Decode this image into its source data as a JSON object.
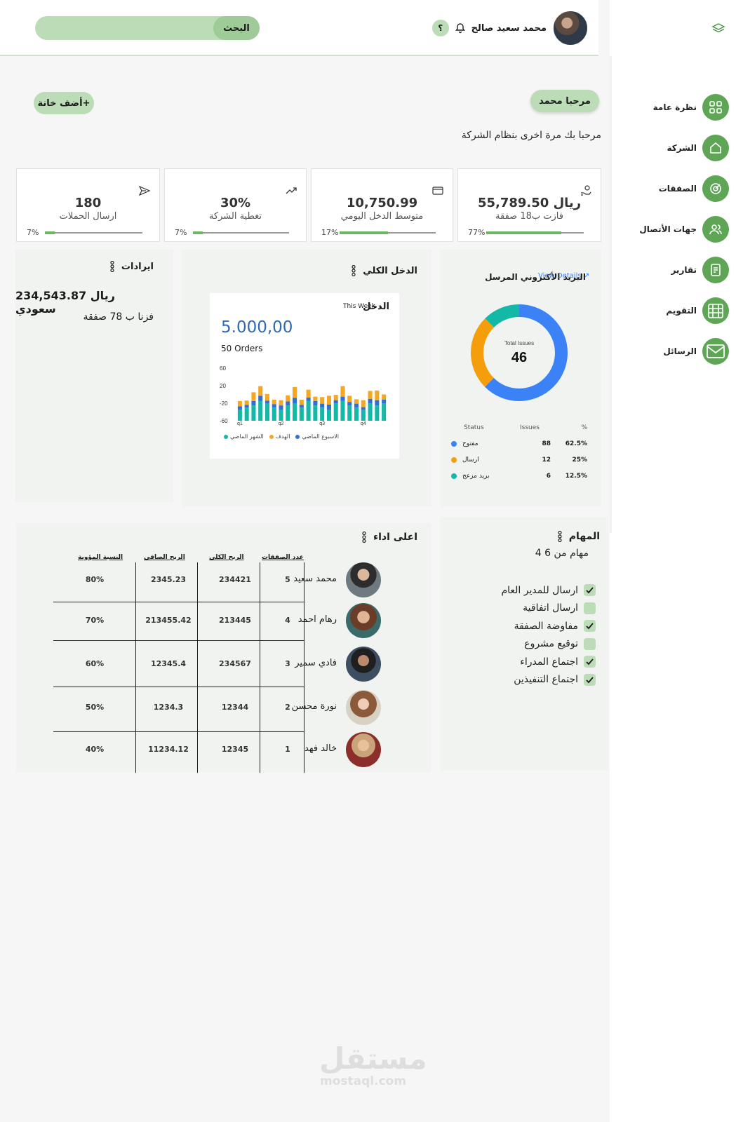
{
  "header": {
    "search_label": "البحث",
    "user_name": "محمد سعيد صالح",
    "help_label": "؟"
  },
  "sidebar": {
    "items": [
      {
        "label": "نظرة عامة",
        "icon": "grid-icon"
      },
      {
        "label": "الشركة",
        "icon": "home-icon"
      },
      {
        "label": "الصفقات",
        "icon": "target-icon"
      },
      {
        "label": "جهات الأتصال",
        "icon": "users-icon"
      },
      {
        "label": "تقارير",
        "icon": "report-icon"
      },
      {
        "label": "التقويم",
        "icon": "calendar-icon"
      },
      {
        "label": "الرسائل",
        "icon": "mail-icon"
      }
    ],
    "accent": "#5ea656"
  },
  "welcome": {
    "button": "مرحبا محمد",
    "message": "مرحبا بك مرة اخرى بنظام الشركة",
    "add_button": "أضف خانة+"
  },
  "stats": [
    {
      "value": "55,789.50 ريال",
      "label": "فازت ب18 صفقة",
      "percent_text": "77%",
      "progress": 0.77,
      "icon": "money-hand-icon"
    },
    {
      "value": "10,750.99",
      "label": "متوسط الدخل اليومي",
      "percent_text": "17%",
      "progress": 0.5,
      "icon": "card-icon"
    },
    {
      "value": "30%",
      "label": "تغطية الشركة",
      "percent_text": "7%",
      "progress": 0.1,
      "icon": "trend-up-icon"
    },
    {
      "value": "180",
      "label": "ارسال الحملات",
      "percent_text": "7%",
      "progress": 0.1,
      "icon": "send-icon"
    }
  ],
  "revenue": {
    "title": "ايرادات",
    "amount": "234,543.87 ريال سعودي",
    "deals": "فزنا ب 78 صفقة"
  },
  "income": {
    "title": "الدخل الكلي",
    "card_title": "الدخل",
    "period": "This Week",
    "amount": "5.000,00",
    "orders": "50 Orders"
  },
  "email": {
    "title": "البريد الأكتروني المرسل",
    "details_link": "View Details",
    "center_label": "Total Issues",
    "total": "46",
    "headers": {
      "status": "Status",
      "issues": "Issues",
      "pct": "%"
    },
    "rows": [
      {
        "status": "مفتوح",
        "issues": "88",
        "pct": "62.5%",
        "color": "#3b82f6"
      },
      {
        "status": "ارسال",
        "issues": "12",
        "pct": "25%",
        "color": "#f59e0b"
      },
      {
        "status": "بريد مزعج",
        "issues": "6",
        "pct": "12.5%",
        "color": "#14b8a6"
      }
    ]
  },
  "performers": {
    "title": "اعلى اداء",
    "headers": {
      "deals": "عدد الصفقات",
      "gross": "الربح الكلي",
      "net": "الربح الصافي",
      "pct": "النسبة المؤوية"
    },
    "rows": [
      {
        "name": "محمد سعيد",
        "deals": "5",
        "gross": "234421",
        "net": "2345.23",
        "pct": "80%"
      },
      {
        "name": "رهام احمد",
        "deals": "4",
        "gross": "213445",
        "net": "213455.42",
        "pct": "70%"
      },
      {
        "name": "فادي سمير",
        "deals": "3",
        "gross": "234567",
        "net": "12345.4",
        "pct": "60%"
      },
      {
        "name": "نورة محسن",
        "deals": "2",
        "gross": "12344",
        "net": "1234.3",
        "pct": "50%"
      },
      {
        "name": "خالد فهد",
        "deals": "1",
        "gross": "12345",
        "net": "11234.12",
        "pct": "40%"
      }
    ]
  },
  "tasks": {
    "title": "المهام",
    "count": "4 مهام من 6",
    "items": [
      {
        "label": "ارسال للمدير العام",
        "done": true
      },
      {
        "label": "ارسال اتفاقية",
        "done": false
      },
      {
        "label": "مفاوضة الصفقة",
        "done": true
      },
      {
        "label": "توقيع مشروع",
        "done": false
      },
      {
        "label": "اجتماع المدراء",
        "done": true
      },
      {
        "label": "اجتماع التنفيذين",
        "done": true
      }
    ]
  },
  "watermark": {
    "logo": "مستقل",
    "url": "mostaql.com"
  },
  "chart_data": {
    "type": "bar",
    "stacked": true,
    "categories": [
      "q1",
      "",
      "",
      "",
      "",
      "",
      "q2",
      "",
      "",
      "",
      "",
      "",
      "q3",
      "",
      "",
      "",
      "",
      "",
      "q4",
      "",
      "",
      ""
    ],
    "ylim": [
      -60,
      60
    ],
    "yticks": [
      "60",
      "20",
      "-20",
      "-60"
    ],
    "series": [
      {
        "name": "الشهر الماضي",
        "color": "#14b8a6",
        "values": [
          25,
          30,
          35,
          45,
          40,
          30,
          25,
          35,
          40,
          30,
          45,
          35,
          30,
          25,
          40,
          45,
          35,
          30,
          25,
          40,
          35,
          40
        ]
      },
      {
        "name": "الاسبوع الماضي",
        "color": "#2f6fd8",
        "values": [
          8,
          6,
          10,
          12,
          6,
          8,
          10,
          9,
          12,
          6,
          8,
          10,
          9,
          12,
          7,
          10,
          8,
          9,
          6,
          10,
          12,
          8
        ]
      },
      {
        "name": "الهدف",
        "color": "#f5a623",
        "values": [
          12,
          10,
          20,
          22,
          15,
          10,
          12,
          14,
          25,
          12,
          18,
          10,
          15,
          20,
          12,
          24,
          14,
          10,
          16,
          18,
          22,
          12
        ]
      }
    ]
  }
}
